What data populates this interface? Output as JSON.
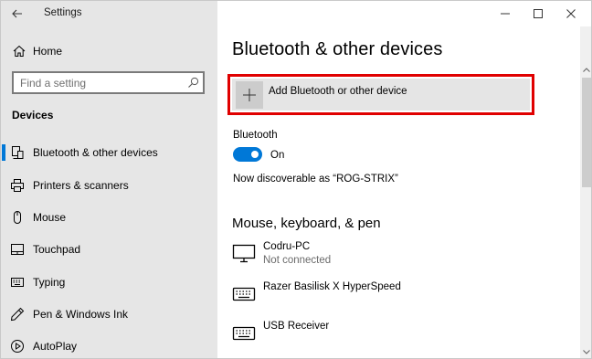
{
  "window": {
    "title": "Settings"
  },
  "sidebar": {
    "home_label": "Home",
    "search_placeholder": "Find a setting",
    "section_title": "Devices",
    "items": [
      {
        "label": "Bluetooth & other devices",
        "icon": "bluetooth-devices-icon",
        "selected": true
      },
      {
        "label": "Printers & scanners",
        "icon": "printer-icon",
        "selected": false
      },
      {
        "label": "Mouse",
        "icon": "mouse-icon",
        "selected": false
      },
      {
        "label": "Touchpad",
        "icon": "touchpad-icon",
        "selected": false
      },
      {
        "label": "Typing",
        "icon": "keyboard-icon",
        "selected": false
      },
      {
        "label": "Pen & Windows Ink",
        "icon": "pen-icon",
        "selected": false
      },
      {
        "label": "AutoPlay",
        "icon": "autoplay-icon",
        "selected": false
      }
    ]
  },
  "main": {
    "page_title": "Bluetooth & other devices",
    "add_device_label": "Add Bluetooth or other device",
    "bluetooth_label": "Bluetooth",
    "bluetooth_state": "On",
    "discoverable_text": "Now discoverable as “ROG-STRIX”",
    "group_title": "Mouse, keyboard, & pen",
    "devices": [
      {
        "name": "Codru-PC",
        "status": "Not connected",
        "icon": "monitor-icon"
      },
      {
        "name": "Razer Basilisk X HyperSpeed",
        "status": "",
        "icon": "keyboard-icon"
      },
      {
        "name": "USB Receiver",
        "status": "",
        "icon": "keyboard-icon"
      }
    ]
  },
  "colors": {
    "accent": "#0078d7",
    "highlight_border": "#e00000",
    "sidebar_bg": "#e6e6e6"
  }
}
